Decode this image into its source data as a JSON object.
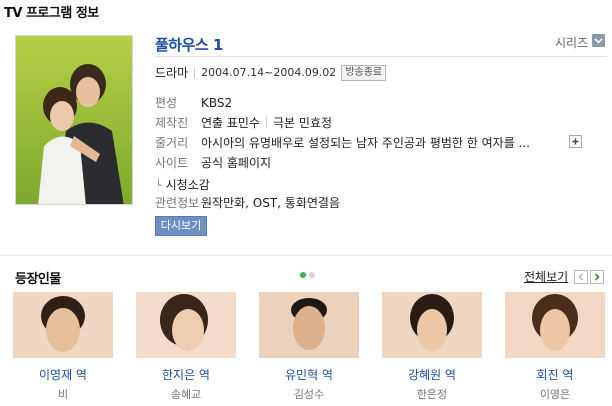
{
  "header": {
    "title": "TV 프로그램 정보"
  },
  "show": {
    "title": "풀하우스 1",
    "series_label": "시리즈",
    "genre": "드라마",
    "dates": "2004.07.14~2004.09.02",
    "status_badge": "방송종료"
  },
  "info_rows": [
    {
      "label": "편성",
      "value": "KBS2"
    },
    {
      "label": "제작진",
      "value": "연출 표민수",
      "value2": "극본 민효정"
    },
    {
      "label": "줄거리",
      "value": "아시아의 유명배우로 설정되는 남자 주인공과 평범한 한 여자를 ..."
    },
    {
      "label": "사이트",
      "value": "공식 홈페이지"
    },
    {
      "label": "관련정보",
      "value": "원작만화, OST, 통화연결음"
    }
  ],
  "review_link": "시청소감",
  "replay_button": "다시보기",
  "cast_section": {
    "title": "등장인물",
    "view_all": "전체보기",
    "active_page": 1,
    "page_count": 2,
    "members": [
      {
        "role": "이영재 역",
        "actor": "비"
      },
      {
        "role": "한지은 역",
        "actor": "송혜교"
      },
      {
        "role": "유민혁 역",
        "actor": "김성수"
      },
      {
        "role": "강혜원 역",
        "actor": "한은정"
      },
      {
        "role": "회진 역",
        "actor": "이영은"
      }
    ]
  },
  "icons": {
    "series_toggle": "chevron-down-icon",
    "expand_synopsis": "plus-icon",
    "prev_page": "chevron-left-icon",
    "next_page": "chevron-right-icon",
    "review_arrow": "corner-arrow-icon"
  },
  "colors": {
    "title_blue": "#1f4fa0",
    "replay_button": "#6f8fc0",
    "active_dot": "#3fb24a",
    "next_arrow": "#2e9a3a"
  }
}
